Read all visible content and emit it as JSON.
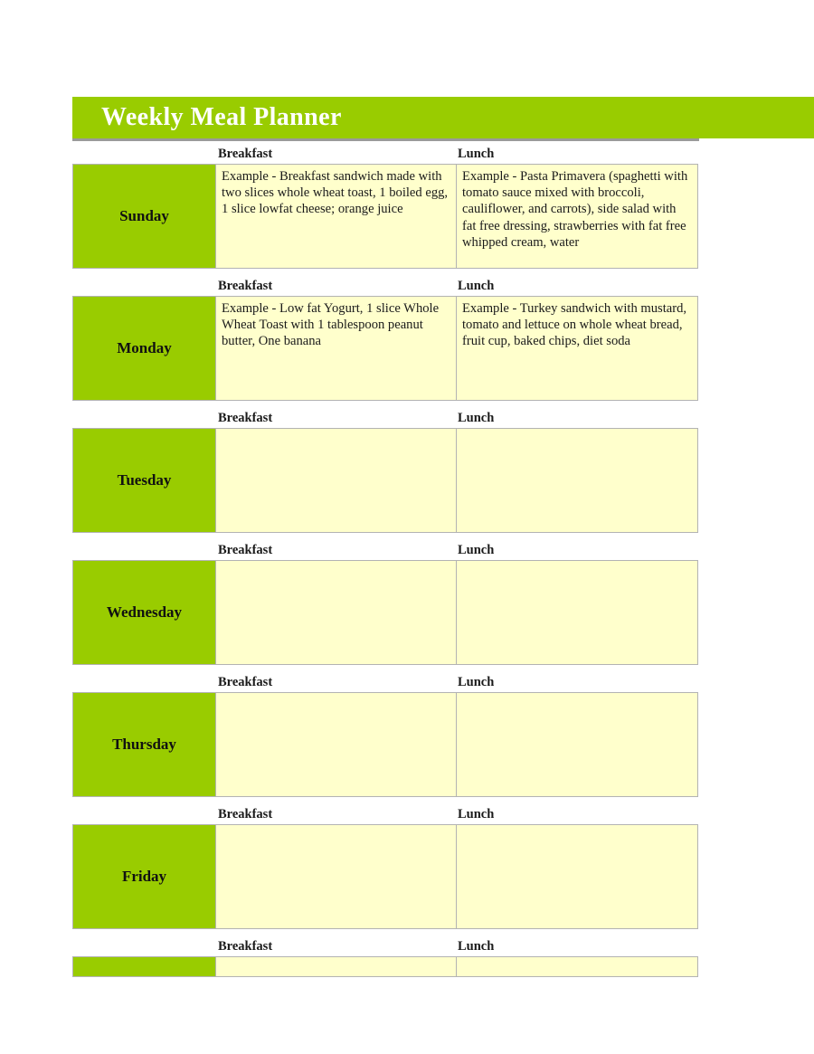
{
  "document": {
    "title": "Weekly Meal Planner",
    "background_color": "#ffffff"
  },
  "theme": {
    "accent_green": "#99cc00",
    "cell_cream": "#ffffcc",
    "border_gray": "#b3b3b3",
    "rule_gray": "#9a9a9a",
    "title_text_color": "#ffffff",
    "body_text_color": "#1a1a1a"
  },
  "columns": {
    "breakfast_label": "Breakfast",
    "lunch_label": "Lunch"
  },
  "days": [
    {
      "name": "Sunday",
      "breakfast": "Example -  Breakfast sandwich made with two slices whole wheat toast, 1 boiled egg, 1 slice lowfat cheese; orange juice",
      "lunch": "Example - Pasta Primavera (spaghetti with tomato sauce mixed with broccoli, cauliflower, and carrots), side salad with fat free dressing, strawberries with fat free whipped cream, water"
    },
    {
      "name": "Monday",
      "breakfast": "Example - Low fat Yogurt, 1 slice Whole Wheat Toast with 1 tablespoon peanut butter, One banana",
      "lunch": "Example - Turkey sandwich with mustard, tomato and lettuce on whole wheat bread, fruit cup, baked chips, diet soda"
    },
    {
      "name": "Tuesday",
      "breakfast": "",
      "lunch": ""
    },
    {
      "name": "Wednesday",
      "breakfast": "",
      "lunch": ""
    },
    {
      "name": "Thursday",
      "breakfast": "",
      "lunch": ""
    },
    {
      "name": "Friday",
      "breakfast": "",
      "lunch": ""
    },
    {
      "name": "",
      "breakfast": "",
      "lunch": ""
    }
  ]
}
